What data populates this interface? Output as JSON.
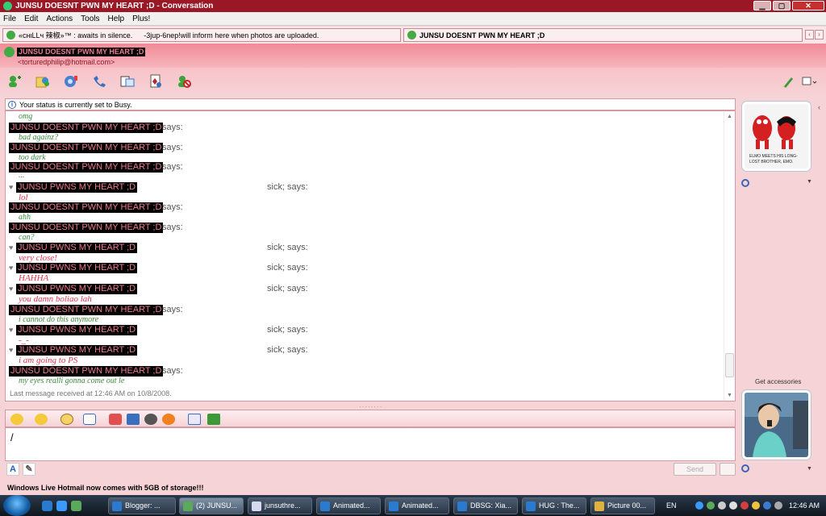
{
  "window": {
    "title": "JUNSU DOESNT PWN MY HEART ;D  - Conversation",
    "controls": [
      "minimize",
      "maximize",
      "close"
    ]
  },
  "menu": [
    "File",
    "Edit",
    "Actions",
    "Tools",
    "Help",
    "Plus!"
  ],
  "tabs": [
    {
      "name": "«cнιLLч 辣椒»™ : awaits in silence.",
      "status": "-3jup-6nep!will inform here when photos are uploaded."
    },
    {
      "name": "JUNSU DOESNT PWN MY HEART ;D"
    }
  ],
  "contact": {
    "name": "JUNSU DOESNT PWN MY HEART ;D",
    "email": "<torturedphilip@hotmail.com>"
  },
  "toolbar_icons": [
    "invite-contact-icon",
    "share-files-icon",
    "video-call-icon",
    "call-icon",
    "activities-icon",
    "games-icon",
    "block-icon"
  ],
  "status_notice": "Your status is currently set to Busy.",
  "conversation": {
    "says": "says:",
    "other_says": "sick; says:",
    "messages": [
      {
        "from": "them",
        "name": "",
        "text": "omg"
      },
      {
        "from": "them",
        "name": "JUNSU DOESNT PWN MY HEART ;D",
        "text": "bad againz?"
      },
      {
        "from": "them",
        "name": "JUNSU DOESNT PWN MY HEART ;D",
        "text": "too dark"
      },
      {
        "from": "them",
        "name": "JUNSU DOESNT PWN MY HEART ;D",
        "text": "..."
      },
      {
        "from": "me",
        "name": "JUNSU PWNS MY HEART ;D",
        "text": "lol"
      },
      {
        "from": "them",
        "name": "JUNSU DOESNT PWN MY HEART ;D",
        "text": "ahh"
      },
      {
        "from": "them",
        "name": "JUNSU DOESNT PWN MY HEART ;D",
        "text": "can?"
      },
      {
        "from": "me",
        "name": "JUNSU PWNS MY HEART ;D",
        "text": "very close!"
      },
      {
        "from": "me",
        "name": "JUNSU PWNS MY HEART ;D",
        "text": "HAHHA"
      },
      {
        "from": "me",
        "name": "JUNSU PWNS MY HEART ;D",
        "text": "you damn boliao lah"
      },
      {
        "from": "them",
        "name": "JUNSU DOESNT PWN MY HEART ;D",
        "text": "i cannot do this anymore"
      },
      {
        "from": "me",
        "name": "JUNSU PWNS MY HEART ;D",
        "text": "-_-"
      },
      {
        "from": "me",
        "name": "JUNSU PWNS MY HEART ;D",
        "text": "i am going to PS"
      },
      {
        "from": "them",
        "name": "JUNSU DOESNT PWN MY HEART ;D",
        "text": "my eyes realli gonna come out le"
      }
    ],
    "last_message": "Last message received at 12:46 AM on 10/8/2008."
  },
  "compose": {
    "value": "",
    "send_label": "Send"
  },
  "sidebar": {
    "get_accessories": "Get accessories",
    "contact_picture": "Elmo meets his long-lost brother, EMO. cartoon",
    "my_picture": "young man singing into microphone photo"
  },
  "ad_text": "Windows Live Hotmail now comes with 5GB of storage!!!",
  "taskbar": {
    "tasks": [
      {
        "label": "Blogger: ...",
        "icon": "blogger-icon",
        "active": false
      },
      {
        "label": "(2) JUNSU...",
        "icon": "messenger-icon",
        "active": true
      },
      {
        "label": "junsuthre...",
        "icon": "folder-icon",
        "active": false
      },
      {
        "label": "Animated...",
        "icon": "ie-icon",
        "active": false
      },
      {
        "label": "Animated...",
        "icon": "ie-icon",
        "active": false
      },
      {
        "label": "DBSG: Xia...",
        "icon": "ie-icon",
        "active": false
      },
      {
        "label": "HUG : The...",
        "icon": "ie-icon",
        "active": false
      },
      {
        "label": "Picture 00...",
        "icon": "picture-icon",
        "active": false
      }
    ],
    "language": "EN",
    "clock": "12:46 AM"
  },
  "colors": {
    "title_bar": "#9a1826",
    "window_bg": "#f6d3d6",
    "name_text": "#ec7b8c",
    "their_text": "#3a8a3a",
    "my_text": "#e0334a"
  }
}
